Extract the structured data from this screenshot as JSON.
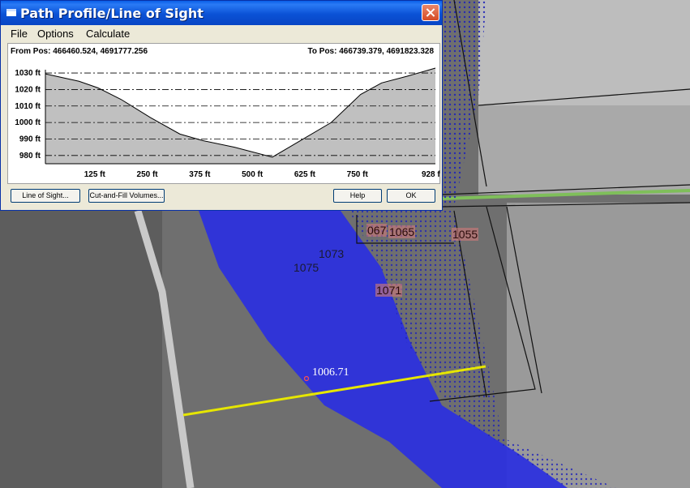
{
  "window": {
    "title": "Path Profile/Line of Sight",
    "close_icon": "close-icon",
    "system_icon": "window-icon"
  },
  "menu": {
    "items": [
      "File",
      "Options",
      "Calculate"
    ]
  },
  "profile": {
    "from_pos": "From Pos: 466460.524, 4691777.256",
    "to_pos": "To Pos: 466739.379, 4691823.328"
  },
  "chart_data": {
    "type": "area",
    "title": "",
    "xlabel": "",
    "ylabel": "",
    "x_unit": "ft",
    "y_unit": "ft",
    "xlim": [
      0,
      928
    ],
    "ylim": [
      975,
      1032
    ],
    "y_ticks": [
      "1030 ft",
      "1020 ft",
      "1010 ft",
      "1000 ft",
      "990 ft",
      "980 ft"
    ],
    "x_ticks": [
      "125 ft",
      "250 ft",
      "375 ft",
      "500 ft",
      "625 ft",
      "750 ft",
      "928 ft"
    ],
    "grid": true,
    "series": [
      {
        "x": [
          0,
          80,
          125,
          180,
          250,
          320,
          375,
          450,
          540,
          600,
          680,
          750,
          800,
          860,
          928
        ],
        "y": [
          1029.5,
          1025,
          1021,
          1014,
          1003,
          993,
          989,
          985,
          979,
          988,
          1000,
          1017,
          1024,
          1028,
          1033
        ]
      }
    ]
  },
  "buttons": {
    "line_of_sight": "Line of Sight...",
    "cut_fill": "Cut-and-Fill Volumes...",
    "help": "Help",
    "ok": "OK"
  },
  "map": {
    "labels": [
      "1073",
      "1075",
      "1071",
      "1055",
      "1065",
      "067"
    ],
    "marker_value": "1006.71",
    "colors": {
      "water": "#2a2fe0",
      "line": "#e6e600"
    }
  }
}
